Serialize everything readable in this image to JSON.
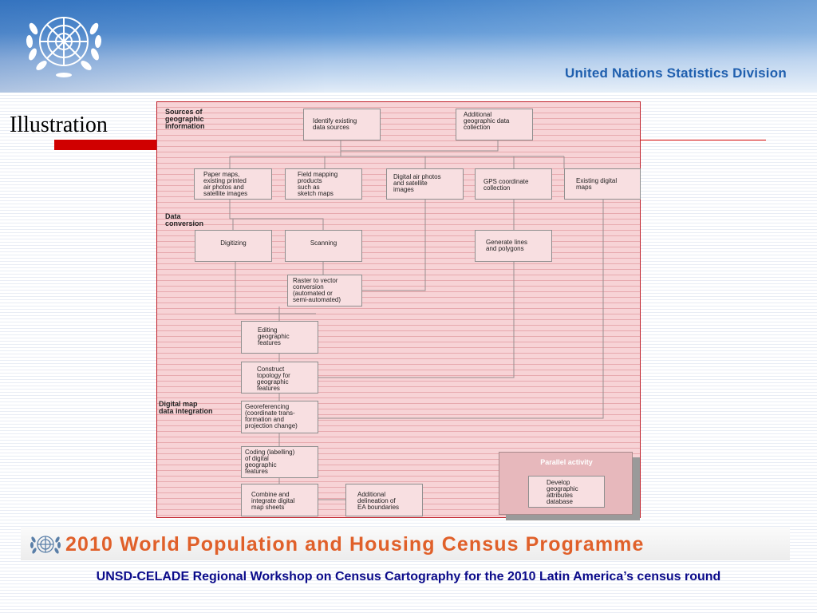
{
  "header": {
    "organization": "United Nations Statistics Division",
    "logo_icon": "un-emblem-icon",
    "accent_color": "#1f5fae"
  },
  "slide": {
    "title": "Illustration",
    "underline_color": "#d00000"
  },
  "diagram": {
    "sections": {
      "sources": [
        "Sources of",
        "geographic",
        "information"
      ],
      "conversion": [
        "Data",
        "conversion"
      ],
      "integration": [
        "Digital map",
        "data integration"
      ]
    },
    "boxes": {
      "identify_sources": [
        "Identify existing",
        "data sources"
      ],
      "additional_collection": [
        "Additional",
        "geographic data",
        "collection"
      ],
      "paper_maps": [
        "Paper maps,",
        "existing printed",
        "air photos and",
        "satellite images"
      ],
      "field_mapping": [
        "Field mapping",
        "products",
        "such as",
        "sketch maps"
      ],
      "digital_air_photos": [
        "Digital air photos",
        "and satellite",
        "images"
      ],
      "gps_collection": [
        "GPS coordinate",
        "collection"
      ],
      "existing_digital_maps": [
        "Existing digital",
        "maps"
      ],
      "digitizing": [
        "Digitizing"
      ],
      "scanning": [
        "Scanning"
      ],
      "generate_lines": [
        "Generate lines",
        "and polygons"
      ],
      "raster_to_vector": [
        "Raster to vector",
        "conversion",
        "(automated or",
        "semi-automated)"
      ],
      "editing": [
        "Editing",
        "geographic",
        "features"
      ],
      "construct_topology": [
        "Construct",
        "topology for",
        "geographic",
        "features"
      ],
      "georeferencing": [
        "Georeferencing",
        "(coordinate trans-",
        "formation and",
        "projection change)"
      ],
      "coding": [
        "Coding (labelling)",
        "of digital",
        "geographic",
        "features"
      ],
      "combine": [
        "Combine and",
        "integrate digital",
        "map sheets"
      ],
      "ea_boundaries": [
        "Additional",
        "delineation of",
        "EA boundaries"
      ],
      "attributes_db": [
        "Develop",
        "geographic",
        "attributes",
        "database"
      ]
    },
    "parallel_title": "Parallel activity",
    "frame_color": "#c0202a",
    "fill_color": "#f7d3d6"
  },
  "footer": {
    "programme": "2010 World Population and Housing Census Programme",
    "programme_color": "#e0602a",
    "logo_icon": "un-emblem-icon",
    "workshop": "UNSD-CELADE Regional Workshop on Census Cartography for the 2010 Latin America’s census round",
    "workshop_color": "#0a0a8a"
  }
}
